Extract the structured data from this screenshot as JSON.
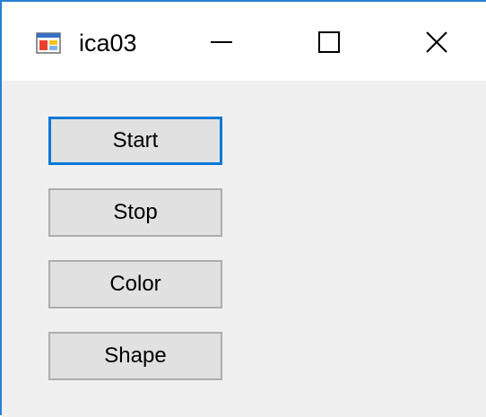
{
  "window": {
    "title": "ica03",
    "icon": "winforms-app-icon",
    "controls": {
      "minimize_icon": "minimize-icon",
      "maximize_icon": "maximize-icon",
      "close_icon": "close-icon"
    },
    "accent_color": "#0078d7",
    "titlebar_color": "#ffffff",
    "client_color": "#f0f0f0"
  },
  "buttons": [
    {
      "label": "Start",
      "focused": true
    },
    {
      "label": "Stop",
      "focused": false
    },
    {
      "label": "Color",
      "focused": false
    },
    {
      "label": "Shape",
      "focused": false
    }
  ]
}
